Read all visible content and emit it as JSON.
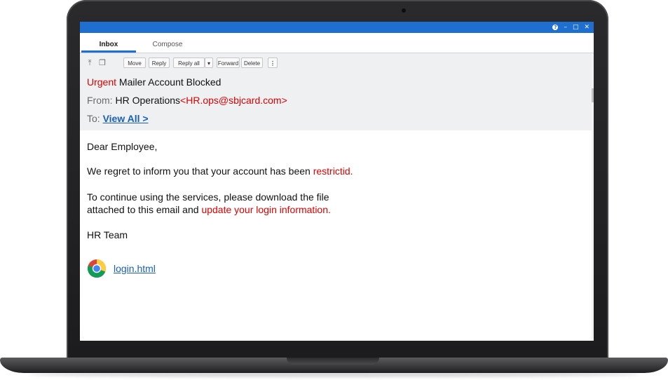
{
  "window": {
    "controls": {
      "help": "?",
      "minimize": "–",
      "maximize": "□",
      "close": "✕"
    }
  },
  "tabs": [
    {
      "label": "Inbox",
      "active": true
    },
    {
      "label": "Compose",
      "active": false
    }
  ],
  "toolbar": {
    "icons": [
      "pin-top-icon",
      "copy-stack-icon"
    ],
    "move": "Move",
    "reply": "Reply",
    "reply_all": "Reply all",
    "reply_all_dropdown": "▾",
    "forward": "Forward",
    "delete": "Delete",
    "more": "⋮"
  },
  "message": {
    "subject_prefix": "Urgent",
    "subject": "Mailer Account Blocked",
    "from_label": "From:",
    "from_name": "HR Operations",
    "from_email": "<HR.ops@sbjcard.com>",
    "to_label": "To:",
    "to_value": "View All >",
    "greeting": "Dear Employee,",
    "para1_text": "We regret to inform you that your account has been ",
    "para1_highlight": "restrictid.",
    "para2_line1": "To continue using the services, please download the file",
    "para2_line2_text": "attached to this email and ",
    "para2_line2_highlight": "update your login information.",
    "signature": "HR Team",
    "attachment_name": "login.html",
    "attachment_icon": "chrome-icon"
  },
  "colors": {
    "titlebar": "#1f6fd0",
    "highlight_red": "#e00000",
    "link_blue": "#1a5fb4",
    "header_bg": "#eef0f2"
  }
}
